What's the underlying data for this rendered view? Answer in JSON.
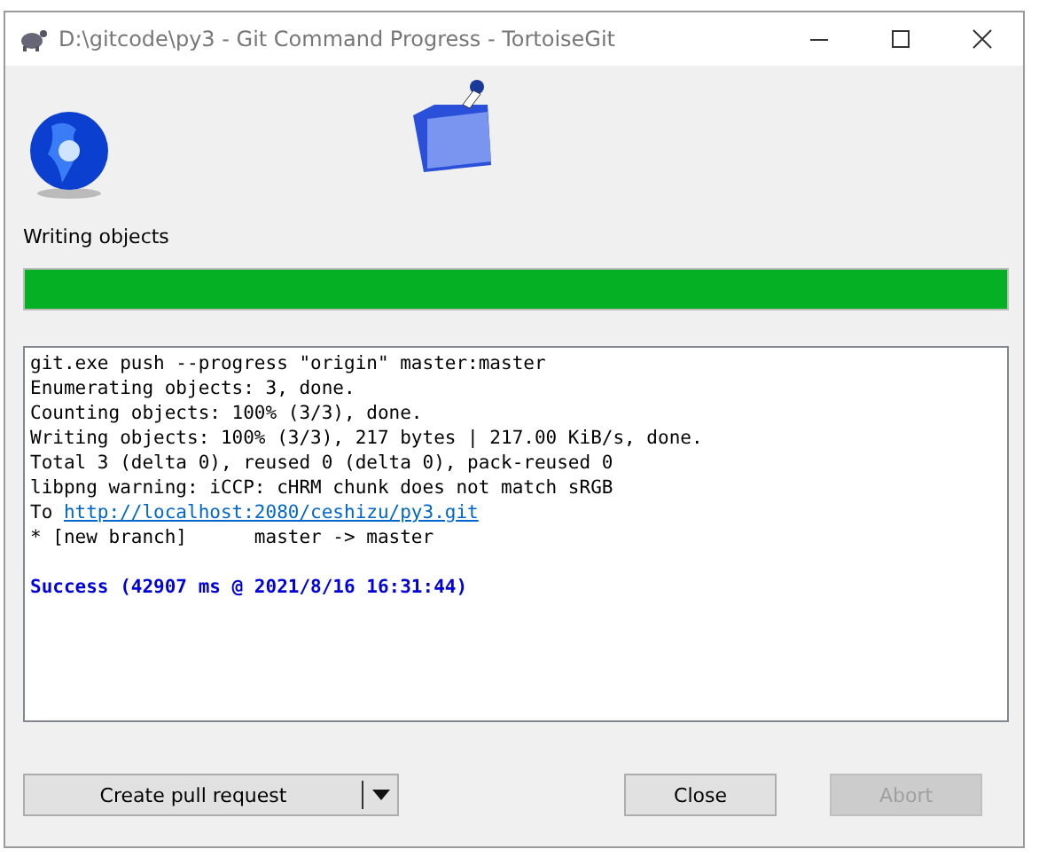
{
  "window": {
    "title": "D:\\gitcode\\py3 - Git Command Progress - TortoiseGit"
  },
  "progress": {
    "label": "Writing objects",
    "level": 1
  },
  "log": [
    {
      "kind": "text",
      "text": "git.exe push --progress \"origin\" master:master"
    },
    {
      "kind": "text",
      "text": "Enumerating objects: 3, done."
    },
    {
      "kind": "text",
      "text": "Counting objects: 100% (3/3), done."
    },
    {
      "kind": "text",
      "text": "Writing objects: 100% (3/3), 217 bytes | 217.00 KiB/s, done."
    },
    {
      "kind": "text",
      "text": "Total 3 (delta 0), reused 0 (delta 0), pack-reused 0"
    },
    {
      "kind": "text",
      "text": "libpng warning: iCCP: cHRM chunk does not match sRGB"
    },
    {
      "kind": "link",
      "prefix": "To ",
      "text": "http://localhost:2080/ceshizu/py3.git"
    },
    {
      "kind": "text",
      "text": "* [new branch]      master -> master"
    },
    {
      "kind": "success",
      "text": "Success (42907 ms @ 2021/8/16 16:31:44)"
    }
  ],
  "buttons": [
    {
      "kind": "split",
      "label": "Create pull request",
      "disabled": false
    },
    {
      "kind": "plain",
      "label": "Close",
      "disabled": false
    },
    {
      "kind": "plain",
      "label": "Abort",
      "disabled": true
    }
  ]
}
